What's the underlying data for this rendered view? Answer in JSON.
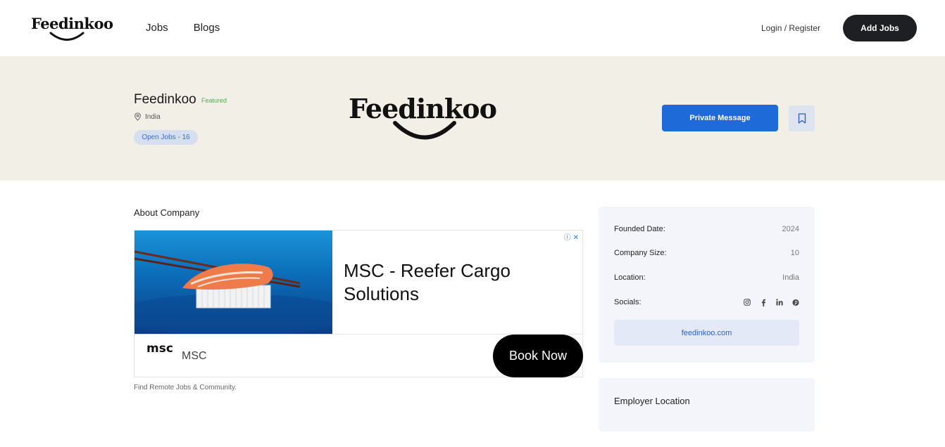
{
  "header": {
    "logo_text": "Feedinkoo",
    "nav": [
      "Jobs",
      "Blogs"
    ],
    "login_label": "Login / Register",
    "add_jobs_label": "Add Jobs"
  },
  "company": {
    "name": "Feedinkoo",
    "badge": "Featured",
    "location": "India",
    "open_jobs": "Open Jobs - 16",
    "logo_text": "Feedinkoo",
    "private_message_label": "Private Message"
  },
  "about": {
    "title": "About Company",
    "tagline": "Find Remote Jobs & Community."
  },
  "ad": {
    "headline": "MSC - Reefer Cargo Solutions",
    "advertiser": "MSC",
    "logo_text": "msc",
    "cta": "Book Now"
  },
  "info": {
    "rows": [
      {
        "label": "Founded Date:",
        "value": "2024"
      },
      {
        "label": "Company Size:",
        "value": "10"
      },
      {
        "label": "Location:",
        "value": "India"
      }
    ],
    "socials_label": "Socials:",
    "socials_icons": [
      "instagram-icon",
      "facebook-icon",
      "linkedin-icon",
      "pinterest-icon"
    ],
    "website": "feedinkoo.com"
  },
  "employer_location": {
    "title": "Employer Location"
  },
  "colors": {
    "banner_bg": "#f2efe6",
    "primary_blue": "#1d6ad8",
    "dark_button": "#1e1f22",
    "featured_green": "#4caf50"
  }
}
